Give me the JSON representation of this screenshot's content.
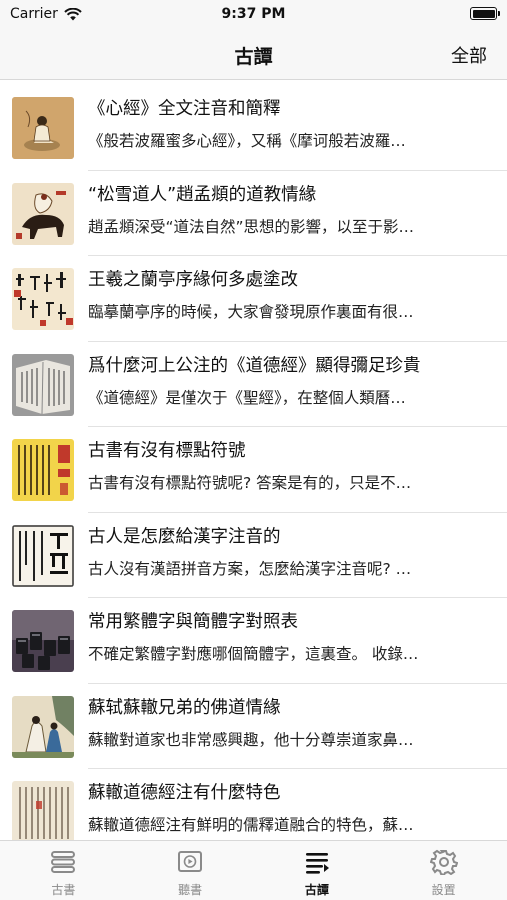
{
  "status": {
    "carrier": "Carrier",
    "time": "9:37 PM"
  },
  "header": {
    "title": "古譚",
    "right_button": "全部"
  },
  "articles": [
    {
      "title": "《心經》全文注音和簡釋",
      "summary": "《般若波羅蜜多心經》，又稱《摩诃般若波羅…",
      "thumb": "buddha-painting"
    },
    {
      "title": "“松雪道人”趙孟頫的道教情緣",
      "summary": "趙孟頫深受“道法自然”思想的影響，以至于影…",
      "thumb": "horse-rider-painting"
    },
    {
      "title": "王羲之蘭亭序緣何多處塗改",
      "summary": "臨摹蘭亭序的時候，大家會發現原作裏面有很…",
      "thumb": "calligraphy-red"
    },
    {
      "title": "爲什麼河上公注的《道德經》顯得彌足珍貴",
      "summary": "《道德經》是僅次于《聖經》，在整個人類曆…",
      "thumb": "old-book"
    },
    {
      "title": "古書有沒有標點符號",
      "summary": "古書有沒有標點符號呢? 答案是有的，只是不…",
      "thumb": "yellow-manuscript"
    },
    {
      "title": "古人是怎麼給漢字注音的",
      "summary": "古人沒有漢語拼音方案，怎麼給漢字注音呢? …",
      "thumb": "dictionary-page"
    },
    {
      "title": "常用繁體字與簡體字對照表",
      "summary": "不確定繁體字對應哪個簡體字，這裏查。 收錄…",
      "thumb": "type-blocks"
    },
    {
      "title": "蘇轼蘇轍兄弟的佛道情緣",
      "summary": "蘇轍對道家也非常感興趣，他十分尊崇道家鼻…",
      "thumb": "scholars-painting"
    },
    {
      "title": "蘇轍道德經注有什麼特色",
      "summary": "蘇轍道德經注有鮮明的儒釋道融合的特色，蘇…",
      "thumb": "manuscript-scroll"
    }
  ],
  "tabs": [
    {
      "label": "古書",
      "icon": "books-icon",
      "active": false
    },
    {
      "label": "聽書",
      "icon": "play-video-icon",
      "active": false
    },
    {
      "label": "古譚",
      "icon": "list-icon",
      "active": true
    },
    {
      "label": "設置",
      "icon": "gear-icon",
      "active": false
    }
  ]
}
